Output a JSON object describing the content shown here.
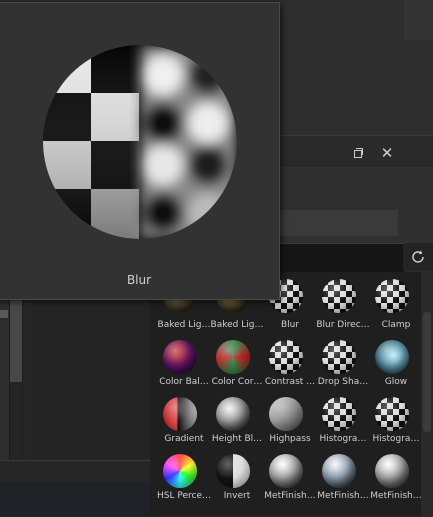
{
  "window": {
    "restore_icon": "restore-window-icon",
    "close_icon": "close-icon",
    "close_glyph": "✕"
  },
  "search": {
    "placeholder": "",
    "value": ""
  },
  "toolbar": {
    "refresh_icon": "refresh-icon"
  },
  "preview": {
    "label": "Blur"
  },
  "palette": {
    "items": [
      {
        "label": "Baked Lig…",
        "style": "baked1"
      },
      {
        "label": "Baked Lig…",
        "style": "baked2"
      },
      {
        "label": "Blur",
        "style": "checker"
      },
      {
        "label": "Blur Direc…",
        "style": "checker"
      },
      {
        "label": "Clamp",
        "style": "checker"
      },
      {
        "label": "Color Bal…",
        "style": "colorbal"
      },
      {
        "label": "Color Cor…",
        "style": "colorcor"
      },
      {
        "label": "Contrast …",
        "style": "checker"
      },
      {
        "label": "Drop Sha…",
        "style": "checker"
      },
      {
        "label": "Glow",
        "style": "glow"
      },
      {
        "label": "Gradient",
        "style": "gradient"
      },
      {
        "label": "Height Bl…",
        "style": "height"
      },
      {
        "label": "Highpass",
        "style": "highpass"
      },
      {
        "label": "Histogra…",
        "style": "checker"
      },
      {
        "label": "Histogra…",
        "style": "checker"
      },
      {
        "label": "HSL Perce…",
        "style": "hsl"
      },
      {
        "label": "Invert",
        "style": "invert"
      },
      {
        "label": "MetFinish…",
        "style": "metal"
      },
      {
        "label": "MetFinish…",
        "style": "metal2"
      },
      {
        "label": "MetFinish…",
        "style": "metal"
      }
    ]
  }
}
